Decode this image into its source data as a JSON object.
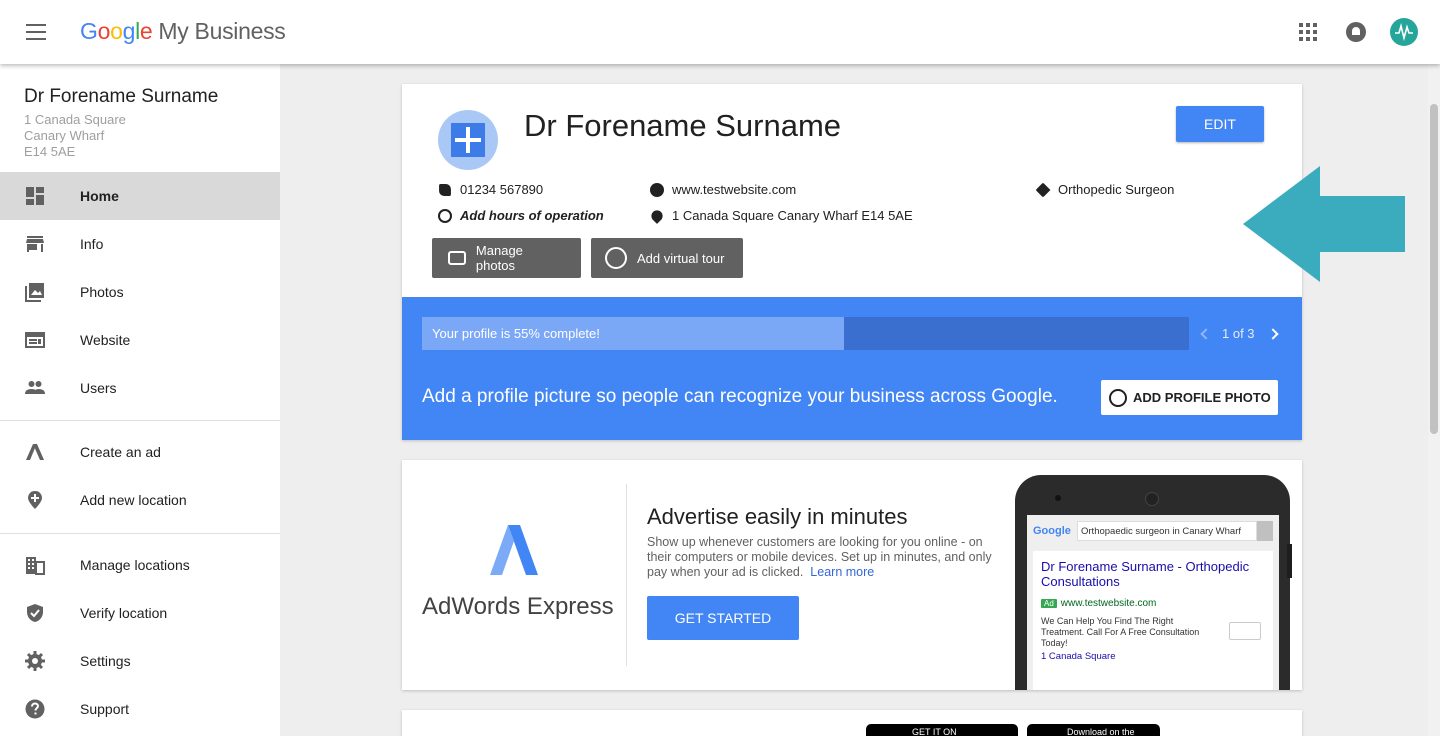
{
  "header": {
    "logo_google": [
      "G",
      "o",
      "o",
      "g",
      "l",
      "e"
    ],
    "logo_product": "My Business"
  },
  "sidebar": {
    "business_name": "Dr Forename Surname",
    "address": [
      "1 Canada Square",
      "Canary Wharf",
      "E14 5AE"
    ],
    "items": [
      {
        "label": "Home",
        "icon": "dashboard-icon",
        "active": true
      },
      {
        "label": "Info",
        "icon": "storefront-icon"
      },
      {
        "label": "Photos",
        "icon": "photos-icon"
      },
      {
        "label": "Website",
        "icon": "website-icon"
      },
      {
        "label": "Users",
        "icon": "users-icon"
      },
      {
        "label": "Create an ad",
        "icon": "adwords-icon"
      },
      {
        "label": "Add new location",
        "icon": "add-location-icon"
      },
      {
        "label": "Manage locations",
        "icon": "building-icon"
      },
      {
        "label": "Verify location",
        "icon": "shield-check-icon"
      },
      {
        "label": "Settings",
        "icon": "gear-icon"
      },
      {
        "label": "Support",
        "icon": "help-icon"
      }
    ]
  },
  "profile": {
    "name": "Dr Forename Surname",
    "edit_label": "EDIT",
    "phone": "01234 567890",
    "hours": "Add hours of operation",
    "website": "www.testwebsite.com",
    "address": "1 Canada Square Canary Wharf E14 5AE",
    "category": "Orthopedic Surgeon",
    "manage_photos": "Manage photos",
    "add_virtual_tour": "Add virtual tour",
    "progress_text": "Your profile is 55% complete!",
    "progress_percent": 55,
    "pager": "1 of 3",
    "tip": "Add a profile picture so people can recognize your business across Google.",
    "add_photo_label": "ADD PROFILE PHOTO"
  },
  "adwords": {
    "brand": "AdWords Express",
    "title": "Advertise easily in minutes",
    "description": "Show up whenever customers are looking for you online - on their computers or mobile devices. Set up in minutes, and only pay when your ad is clicked.",
    "learn_more": "Learn more",
    "cta": "GET STARTED",
    "phone_mock": {
      "google": "Google",
      "query": "Orthopaedic surgeon in Canary Wharf",
      "result_title": "Dr Forename Surname - Orthopedic Consultations",
      "ad_badge": "Ad",
      "result_url": "www.testwebsite.com",
      "result_desc": "We Can Help You Find The Right Treatment. Call For A Free Consultation Today!",
      "result_location": "1 Canada Square"
    }
  },
  "stores": {
    "google_play": "GET IT ON",
    "app_store": "Download on the"
  },
  "colors": {
    "accent": "#4285f4",
    "arrow": "#3aacbd"
  }
}
